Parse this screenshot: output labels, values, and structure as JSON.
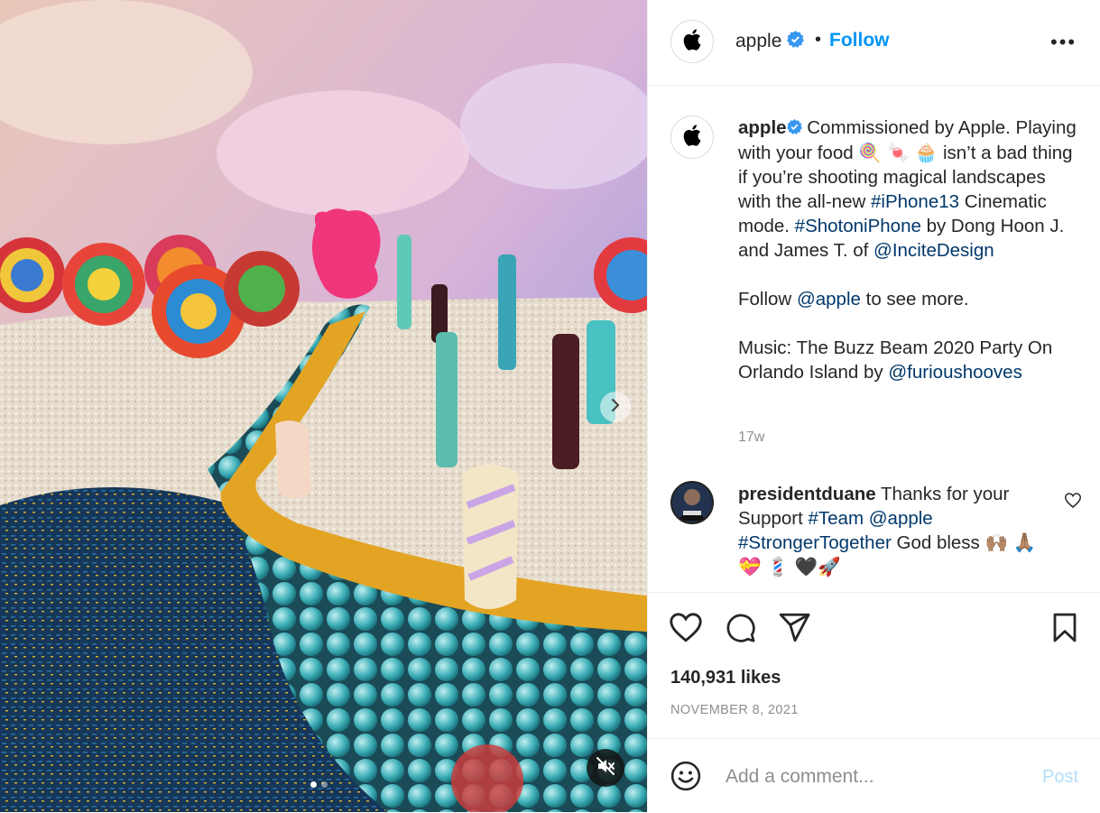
{
  "post": {
    "username": "apple",
    "follow_label": "Follow",
    "separator": "•",
    "more_label": "•••"
  },
  "caption": {
    "username": "apple",
    "text1": " Commissioned by Apple. Playing with your food 🍭 🍬 🧁 isn’t a bad thing if you’re shooting magical landscapes with the all-new ",
    "tag1": "#iPhone13",
    "text2": " Cinematic mode. ",
    "tag2": "#ShotoniPhone",
    "text3": " by Dong Hoon J. and James T. of ",
    "mention1": "@InciteDesign",
    "follow_text_a": "Follow ",
    "follow_mention": "@apple",
    "follow_text_b": " to see more.",
    "music_text": "Music: The Buzz Beam 2020 Party On Orlando Island by ",
    "music_mention": "@furioushooves",
    "age": "17w"
  },
  "comment": {
    "username": "presidentduane",
    "text1": " Thanks for your Support ",
    "tag1": "#Team",
    "space": " ",
    "mention1": "@apple",
    "tag2": "#StrongerTogether",
    "text2": " God bless 🙌🏽 🙏🏽",
    "emoji_line": "💝 💈 🖤🚀"
  },
  "stats": {
    "likes": "140,931 likes",
    "date": "NOVEMBER 8, 2021"
  },
  "comment_box": {
    "placeholder": "Add a comment...",
    "post_label": "Post"
  },
  "carousel": {
    "count": 2,
    "active_index": 0
  },
  "colors": {
    "accent": "#0095f6",
    "link": "#00376b",
    "muted": "#8e8e8e",
    "post_disabled": "#b2dffc"
  }
}
